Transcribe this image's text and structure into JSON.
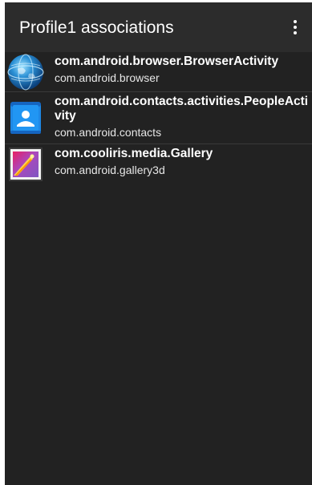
{
  "app_bar": {
    "title": "Profile1 associations",
    "menu_icon": "more-vert-icon"
  },
  "associations": [
    {
      "activity": "com.android.browser.BrowserActivity",
      "package": "com.android.browser",
      "icon": "browser-globe-icon"
    },
    {
      "activity": "com.android.contacts.activities.PeopleActivity",
      "package": "com.android.contacts",
      "icon": "contacts-icon"
    },
    {
      "activity": "com.cooliris.media.Gallery",
      "package": "com.android.gallery3d",
      "icon": "gallery-icon"
    }
  ],
  "colors": {
    "background": "#222222",
    "app_bar": "#2c2c2c",
    "text_primary": "#ffffff",
    "contacts_blue": "#1e88e5"
  }
}
